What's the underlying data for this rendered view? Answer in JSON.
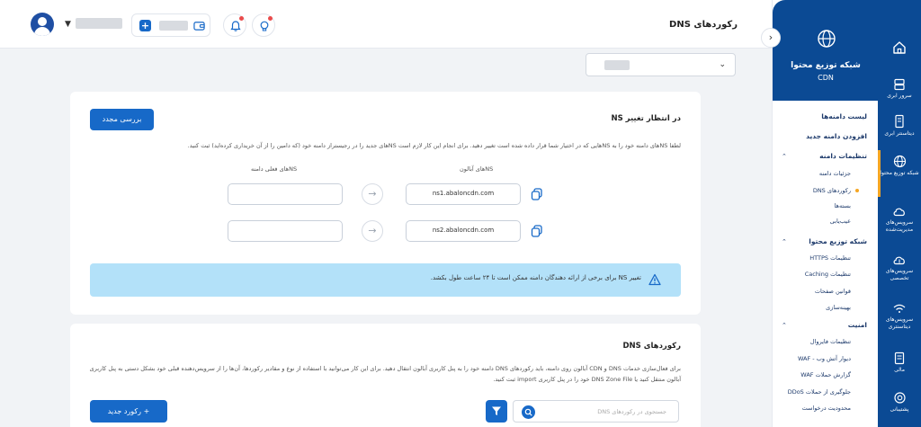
{
  "header": {
    "page_title": "رکوردهای DNS"
  },
  "card_ns": {
    "title": "در انتظار تغییر NS",
    "recheck_label": "بررسی مجدد",
    "description": "لطفا NSهای دامنه خود را به NSهایی که در اختیار شما قرار داده شده است تغییر دهید. برای انجام این کار لازم است NSهای جدید را در رجیستراز دامنه خود (که دامین را از آن خریداری کرده‌اید) ثبت کنید.",
    "col_abalon": "NSهای آبالون",
    "col_current": "NSهای فعلی دامنه",
    "ns": [
      "ns1.abaloncdn.com",
      "ns2.abaloncdn.com"
    ],
    "current_ns": [
      "",
      ""
    ],
    "notice": "تغییر NS برای برخی از ارائه دهندگان دامنه ممکن است تا ۲۴ ساعت طول بکشد."
  },
  "card_dns": {
    "title": "رکوردهای DNS",
    "description": "برای فعال‌سازی خدمات DNS و CDN آبالون روی دامنه، باید رکوردهای DNS دامنه خود را به پنل کاربری آبالون انتقال دهید. برای این کار می‌توانید با استفاده از نوع و مقادیر رکوردها، آن‌ها را از سرویس‌دهنده قبلی خود بشکل دستی به پنل کاربری آبالون منتقل کنید یا DNS Zone File خود را در پنل کاربری import ثبت کنید.",
    "new_record_label": "+ رکورد جدید",
    "search_placeholder": "جستجوی در رکوردهای DNS"
  },
  "panel": {
    "title": "شبکه توزیع محتوا",
    "subtitle": "CDN",
    "menu": {
      "domain_list": "لیست دامنه‌ها",
      "add_domain": "افزودن دامنه جدید",
      "domain_settings": "تنظیمات دامنه",
      "domain_details": "جزئیات دامنه",
      "dns_records": "رکوردهای DNS",
      "packages": "بسته‌ها",
      "troubleshoot": "عیب‌یابی",
      "cdn_settings": "شبکه توزیع محتوا",
      "https_settings": "تنظیمات HTTPS",
      "caching_settings": "تنظیمات Caching",
      "page_rules": "قوانین صفحات",
      "optimization": "بهینه‌سازی",
      "security": "امنیت",
      "firewall": "تنظیمات فایروال",
      "waf": "دیوار آتش وب - WAF",
      "waf_report": "گزارش حملات WAF",
      "ddos": "جلوگیری از حملات DDoS",
      "rate_limit": "محدودیت درخواست"
    }
  },
  "rail": {
    "cloud_server": "سرور ابری",
    "cloud_datacenter": "دیتاسنتر ابری",
    "cdn": "شبکه توزیع محتوا",
    "managed": "سرویس‌های مدیریت‌شده",
    "special": "سرویس‌های تخصصی",
    "datacenter": "سرویس‌های دیتاسنتری",
    "finance": "مالی",
    "support": "پشتیبانی"
  },
  "colors": {
    "primary": "#1769c8",
    "navy": "#0b4a94",
    "notice_bg": "#b3e1f9",
    "accent": "#f5a623"
  }
}
